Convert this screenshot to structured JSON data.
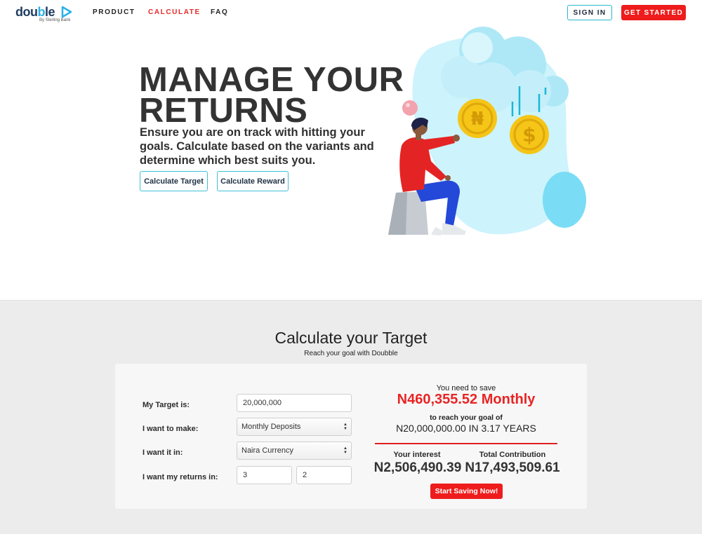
{
  "nav": {
    "logo_text_a": "dou",
    "logo_text_b": "b",
    "logo_text_c": "le",
    "logo_sub": "By Sterling Bank",
    "links": [
      "PRODUCT",
      "CALCULATE",
      "FAQ"
    ],
    "signin": "SIGN IN",
    "get_started": "GET STARTED"
  },
  "hero": {
    "title_line1": "MANAGE YOUR",
    "title_line2": "RETURNS",
    "subtitle": "Ensure you are on track with hitting your goals. Calculate based on the variants and determine which best suits you.",
    "btn_target": "Calculate Target",
    "btn_reward": "Calculate Reward",
    "coin_naira": "₦",
    "coin_dollar": "$"
  },
  "calculator": {
    "title": "Calculate your Target",
    "subtitle": "Reach your goal with Doubble",
    "fields": {
      "target_label": "My Target is:",
      "target_value": "20,000,000",
      "make_label": "I want to make:",
      "make_value": "Monthly Deposits",
      "currency_label": "I want it in:",
      "currency_value": "Naira Currency",
      "returns_label": "I want my returns in:",
      "returns_a": "3",
      "returns_b": "2"
    },
    "result": {
      "need_label": "You need to save",
      "amount": "N460,355.52 Monthly",
      "goal_label": "to reach your goal of",
      "goal": "N20,000,000.00 IN 3.17 YEARS",
      "interest_label": "Your interest",
      "interest_value": "N2,506,490.39",
      "contribution_label": "Total Contribution",
      "contribution_value": "N17,493,509.61",
      "cta": "Start Saving Now!"
    }
  },
  "colors": {
    "brand_red": "#ee1c1c",
    "brand_blue": "#2ab0e8",
    "cloud": "#bdeefc",
    "coin": "#f5c518"
  }
}
